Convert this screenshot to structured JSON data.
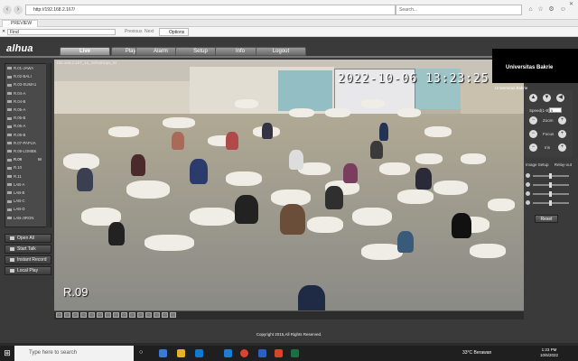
{
  "browser": {
    "url": "http://192.168.2.167/",
    "search_placeholder": "Search...",
    "tab_title": "PREVIEW",
    "find_placeholder": "Find",
    "find_previous": "Previous",
    "find_next": "Next",
    "options_label": "Options"
  },
  "app": {
    "logo": "alhua",
    "nav": [
      "Live",
      "Playback",
      "Alarm",
      "Setup",
      "Info",
      "Logout"
    ],
    "active_nav": "Live"
  },
  "device_tree": {
    "items": [
      "R.01-JAWA",
      "R.02-BALI",
      "R.03-SUMA1",
      "R.04-A",
      "R.04-B",
      "R.05-A",
      "R.05-B",
      "R.06-A",
      "R.06-B",
      "R.07-PAPUA",
      "R.08-LOMBK",
      "R.09",
      "R.10",
      "R.11",
      "LAB-A",
      "LAB-B",
      "LAB-C",
      "LAB-D",
      "LAB-JIRON"
    ],
    "selected_marker": "M"
  },
  "side_buttons": {
    "open_all": "Open All",
    "start_talk": "Start Talk",
    "instant_record": "Instant Record",
    "local_play": "Local Play"
  },
  "video": {
    "info_label": "192.168.2.167_12_18%2Kbps_M",
    "timestamp": "2022-10-06 13:23:25",
    "camera_name": "R.09"
  },
  "right_panel": {
    "banner_title": "Universitas Bakrie",
    "banner_sub": "Universitas Bakrie",
    "speed_label": "Speed(1-8)",
    "speed_value": "5",
    "zoom_label": "Zoom",
    "focus_label": "Focus",
    "iris_label": "Iris",
    "image_setup_label": "Image Setup",
    "relay_out_label": "Relay-out",
    "reset_label": "Reset"
  },
  "footer": {
    "copyright": "Copyright 2015,All Rights Reserved."
  },
  "taskbar": {
    "search_placeholder": "Type here to search",
    "weather": "33°C  Berawan",
    "time": "1:23 PM",
    "date": "10/6/2022"
  }
}
